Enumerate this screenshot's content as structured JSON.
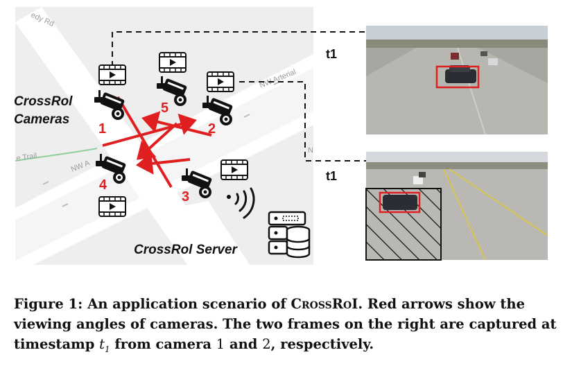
{
  "diagram": {
    "roads": {
      "road_1": "NW Arterial",
      "road_2": "NW A",
      "road_3": "e Trail",
      "road_4": "edy Rd",
      "road_5": "N"
    },
    "cameras_label_line1": "CrossRol",
    "cameras_label_line2": "Cameras",
    "server_label": "CrossRol Server",
    "camera_numbers": [
      "1",
      "2",
      "3",
      "4",
      "5"
    ],
    "timestamp_top": "t1",
    "timestamp_bottom": "t1",
    "colors": {
      "arrow": "#e02020",
      "box": "#e02020",
      "map_bg": "#eeeeee",
      "road": "#ffffff"
    },
    "icons": [
      "camera-icon",
      "video-icon",
      "wifi-icon",
      "server-icon"
    ]
  },
  "caption": {
    "prefix": "Figure 1: An application scenario of ",
    "system": "CrossRoI",
    "middle": ". Red arrows show the viewing angles of cameras. The two frames on the right are captured at timestamp ",
    "ts_var": "t",
    "ts_sub": "1",
    "mid2": " from camera ",
    "cam_a": "1",
    "and": " and ",
    "cam_b": "2",
    "suffix": ", respectively."
  }
}
